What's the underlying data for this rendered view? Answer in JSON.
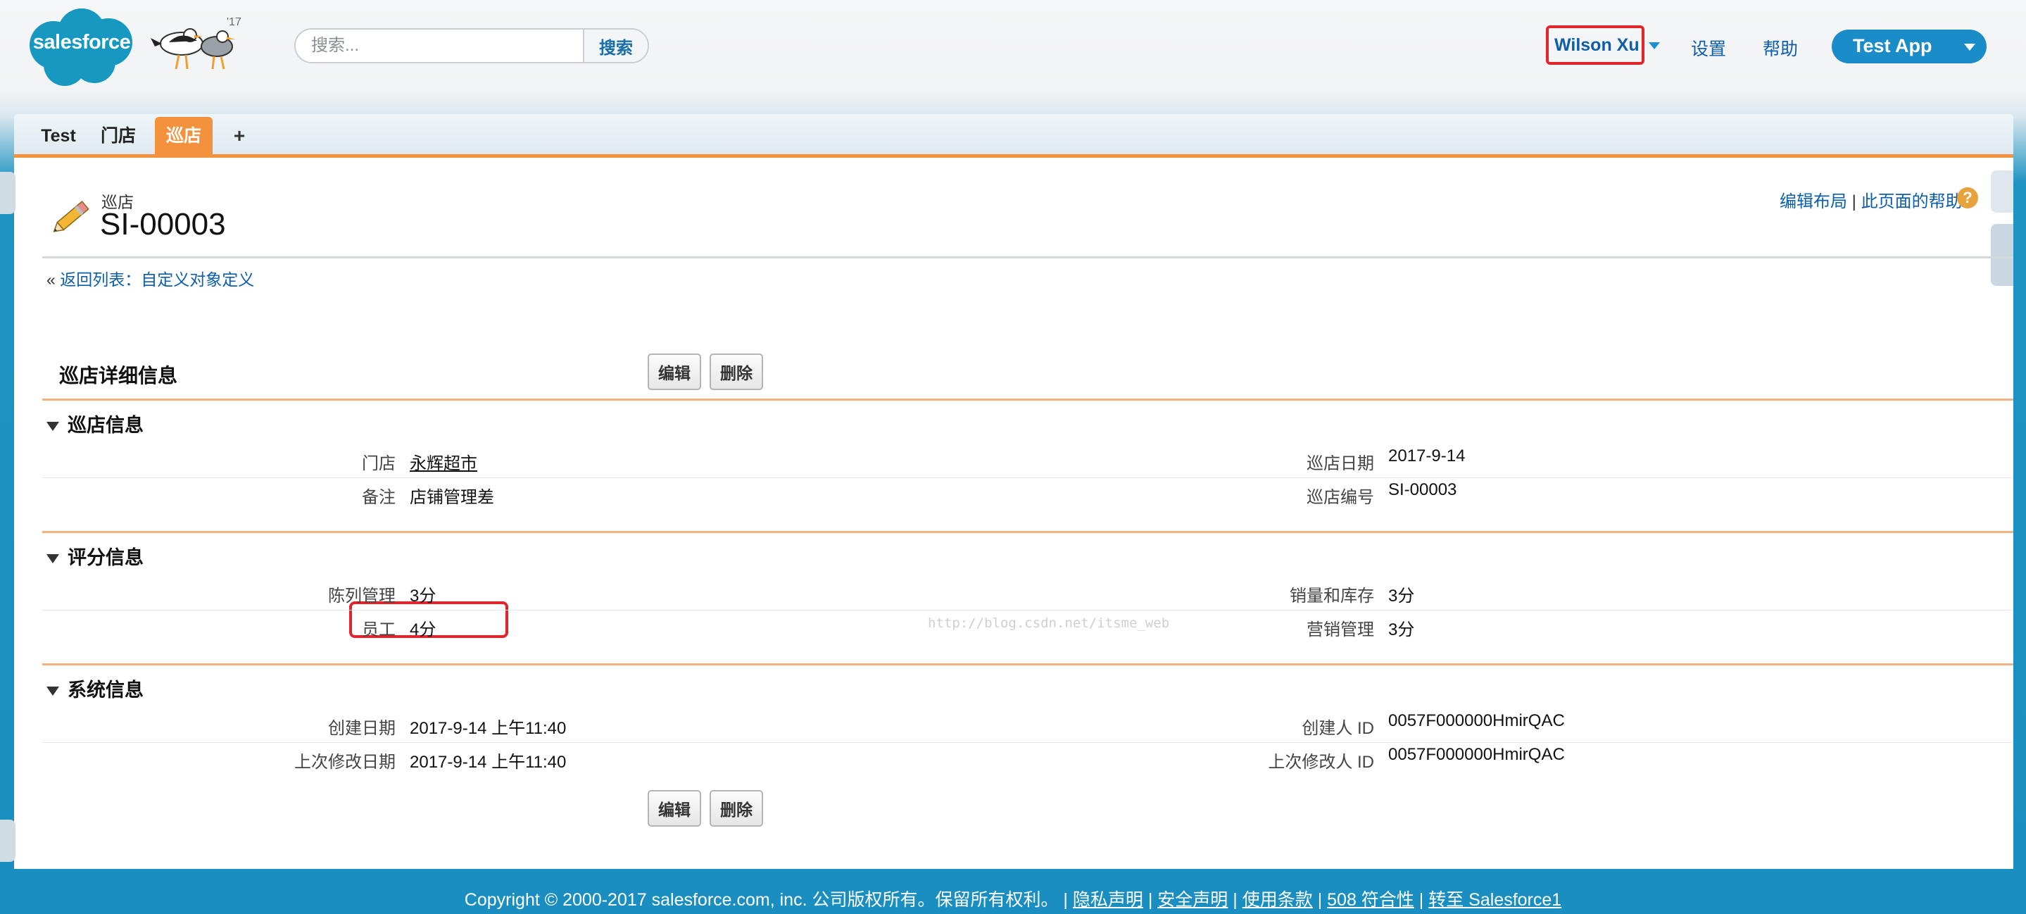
{
  "header": {
    "logo_text": "salesforce",
    "mascot_year": "'17",
    "search_placeholder": "搜索...",
    "search_button": "搜索",
    "user_name": "Wilson Xu",
    "links": [
      "设置",
      "帮助"
    ],
    "app_button": "Test App"
  },
  "tabs": [
    {
      "label": "Test",
      "active": false
    },
    {
      "label": "门店",
      "active": false
    },
    {
      "label": "巡店",
      "active": true
    },
    {
      "label": "+",
      "active": false
    }
  ],
  "page": {
    "type": "巡店",
    "title": "SI-00003",
    "top_links": [
      "编辑布局",
      "此页面的帮助"
    ],
    "help_icon": "?",
    "back_prefix": "«",
    "back_link": "返回列表：自定义对象定义",
    "detail_heading": "巡店详细信息",
    "buttons": {
      "edit": "编辑",
      "delete": "删除"
    },
    "watermark": "http://blog.csdn.net/itsme_web"
  },
  "sections": [
    {
      "title": "巡店信息",
      "rows": [
        [
          {
            "label": "门店",
            "value": "永辉超市",
            "link": true
          },
          {
            "label": "巡店日期",
            "value": "2017-9-14"
          }
        ],
        [
          {
            "label": "备注",
            "value": "店铺管理差"
          },
          {
            "label": "巡店编号",
            "value": "SI-00003"
          }
        ]
      ]
    },
    {
      "title": "评分信息",
      "rows": [
        [
          {
            "label": "陈列管理",
            "value": "3分"
          },
          {
            "label": "销量和库存",
            "value": "3分"
          }
        ],
        [
          {
            "label": "员工",
            "value": "4分"
          },
          {
            "label": "营销管理",
            "value": "3分"
          }
        ]
      ]
    },
    {
      "title": "系统信息",
      "rows": [
        [
          {
            "label": "创建日期",
            "value": "2017-9-14 上午11:40"
          },
          {
            "label": "创建人 ID",
            "value": "0057F000000HmirQAC"
          }
        ],
        [
          {
            "label": "上次修改日期",
            "value": "2017-9-14 上午11:40"
          },
          {
            "label": "上次修改人 ID",
            "value": "0057F000000HmirQAC"
          }
        ]
      ]
    }
  ],
  "footer": {
    "copyright": "Copyright © 2000-2017 salesforce.com, inc. 公司版权所有。保留所有权利。",
    "separator": "|",
    "links": [
      "隐私声明",
      "安全声明",
      "使用条款",
      "508 符合性",
      "转至 Salesforce1"
    ]
  },
  "colors": {
    "accent_orange": "#f4913c",
    "link_blue": "#0e5ea8",
    "app_blue": "#1a8cc8",
    "highlight_red": "#e0262a"
  }
}
